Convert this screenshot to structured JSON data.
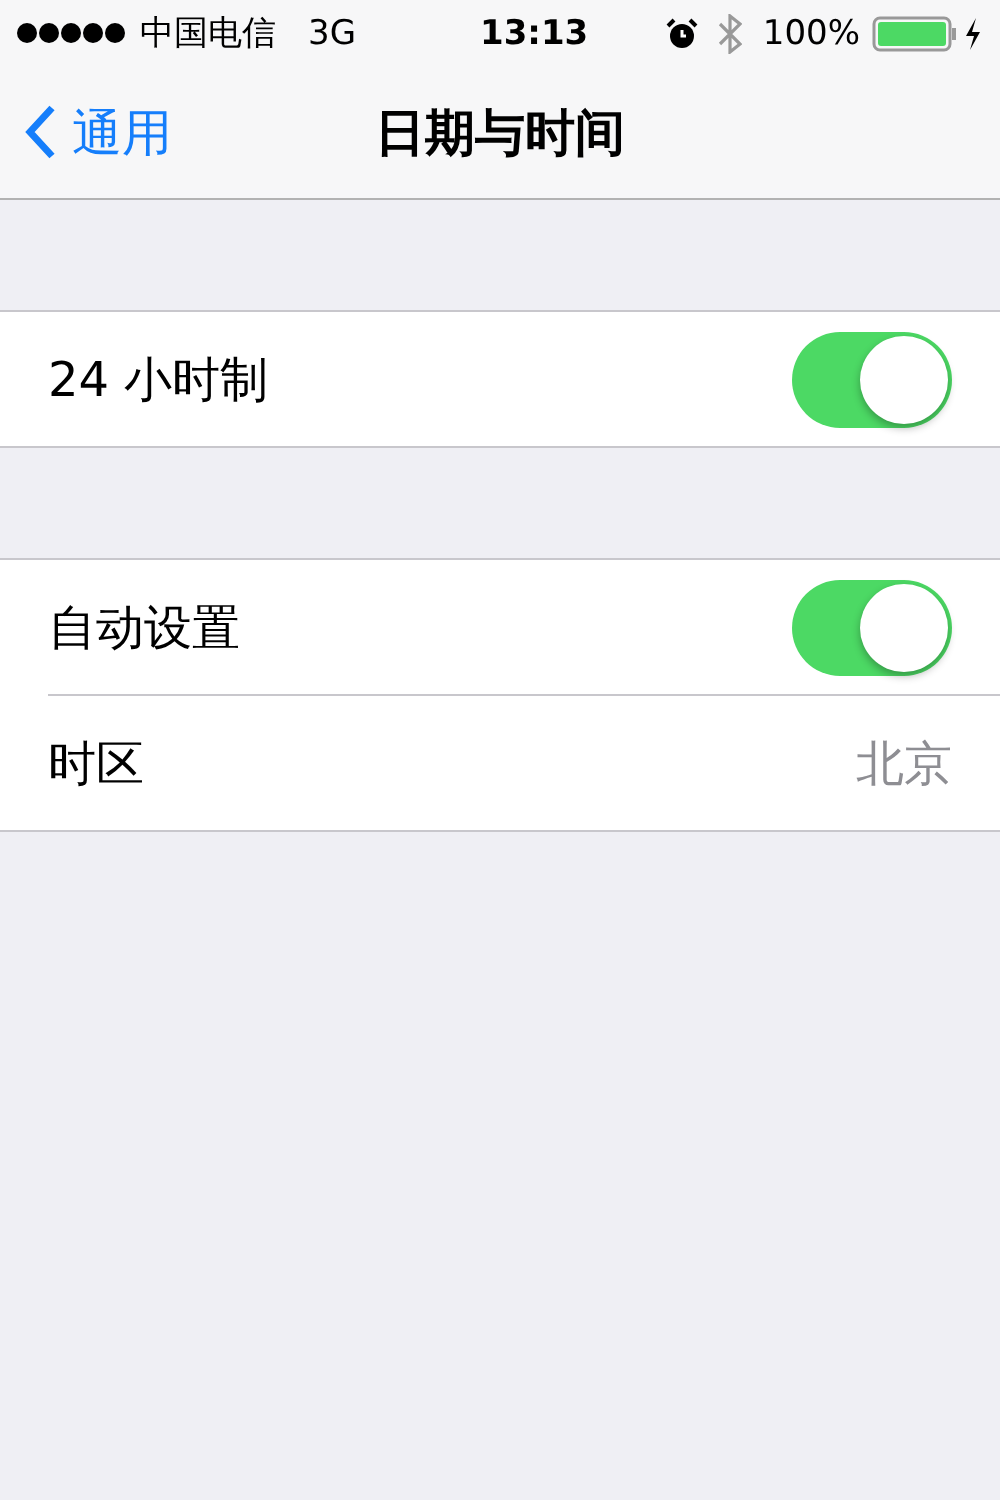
{
  "status_bar": {
    "carrier": "中国电信",
    "network": "3G",
    "time": "13:13",
    "battery": "100%"
  },
  "nav": {
    "back": "通用",
    "title": "日期与时间"
  },
  "groups": [
    {
      "rows": [
        {
          "kind": "toggle",
          "label": "24 小时制",
          "on": true
        }
      ]
    },
    {
      "rows": [
        {
          "kind": "toggle",
          "label": "自动设置",
          "on": true
        },
        {
          "kind": "value",
          "label": "时区",
          "value": "北京"
        }
      ]
    }
  ]
}
